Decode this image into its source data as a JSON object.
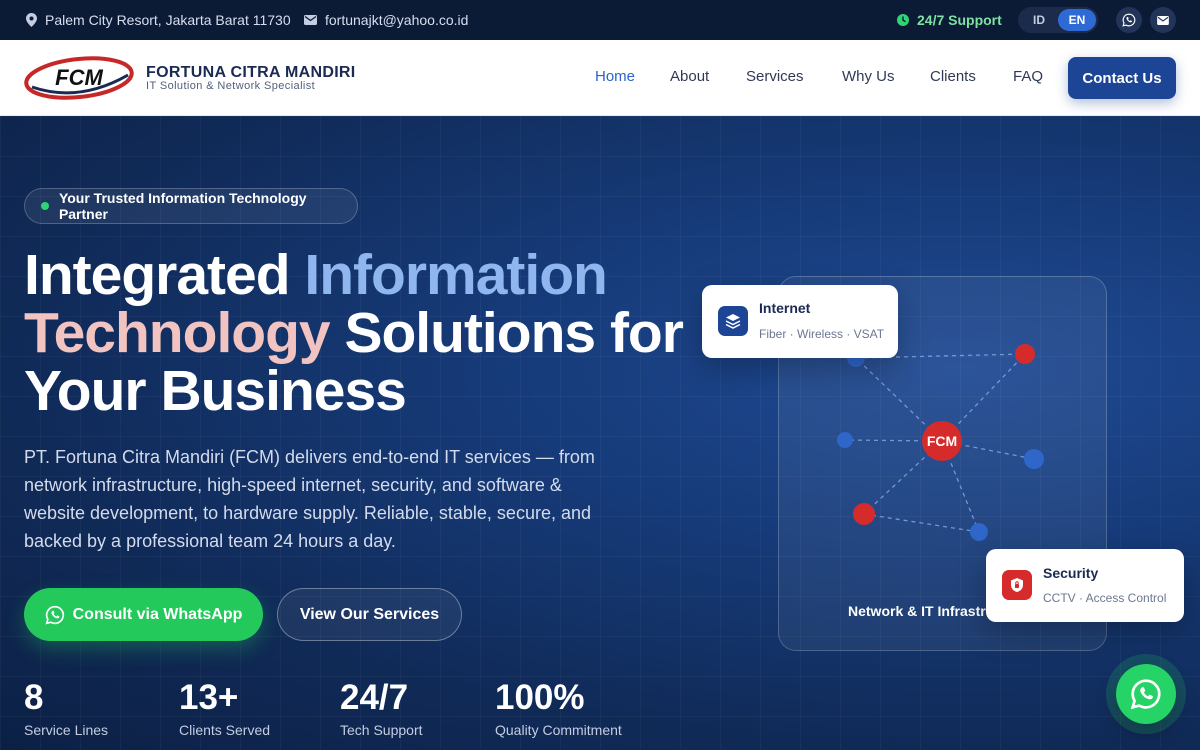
{
  "topbar": {
    "address": "Palem City Resort, Jakarta Barat 11730",
    "email": "fortunajkt@yahoo.co.id",
    "support": "24/7 Support",
    "lang_id": "ID",
    "lang_en": "EN",
    "active_lang": "EN"
  },
  "brand": {
    "logo_text": "FCM",
    "name": "FORTUNA CITRA MANDIRI",
    "tagline": "IT Solution & Network Specialist"
  },
  "nav": {
    "items": [
      "Home",
      "About",
      "Services",
      "Why Us",
      "Clients",
      "FAQ"
    ],
    "active": "Home",
    "cta": "Contact Us"
  },
  "hero": {
    "badge": "Your Trusted Information Technology Partner",
    "headline_1": "Integrated ",
    "headline_2": "Information",
    "headline_3": "Technology",
    "headline_4": " Solutions for",
    "headline_5": "Your Business",
    "lead": "PT. Fortuna Citra Mandiri (FCM) delivers end-to-end IT services — from network infrastructure, high-speed internet, security, and software & website development, to hardware supply. Reliable, stable, secure, and backed by a professional team 24 hours a day.",
    "cta_primary": "Consult via WhatsApp",
    "cta_secondary": "View Our Services"
  },
  "stats": [
    {
      "value": "8",
      "label": "Service Lines"
    },
    {
      "value": "13+",
      "label": "Clients Served"
    },
    {
      "value": "24/7",
      "label": "Tech Support"
    },
    {
      "value": "100%",
      "label": "Quality Commitment"
    }
  ],
  "network": {
    "center_label": "FCM",
    "caption": "Network & IT Infrastructure",
    "internet_title": "Internet",
    "internet_sub": "Fiber · Wireless · VSAT",
    "security_title": "Security",
    "security_sub": "CCTV · Access Control"
  },
  "colors": {
    "accent": "#2c62c9",
    "cta_dark": "#1d4595",
    "whatsapp": "#24c95c",
    "node_red": "#d62b2b",
    "node_blue": "#2f66c9"
  },
  "icons": [
    "location-icon",
    "mail-icon",
    "whatsapp-icon",
    "layers-icon",
    "shield-icon"
  ]
}
